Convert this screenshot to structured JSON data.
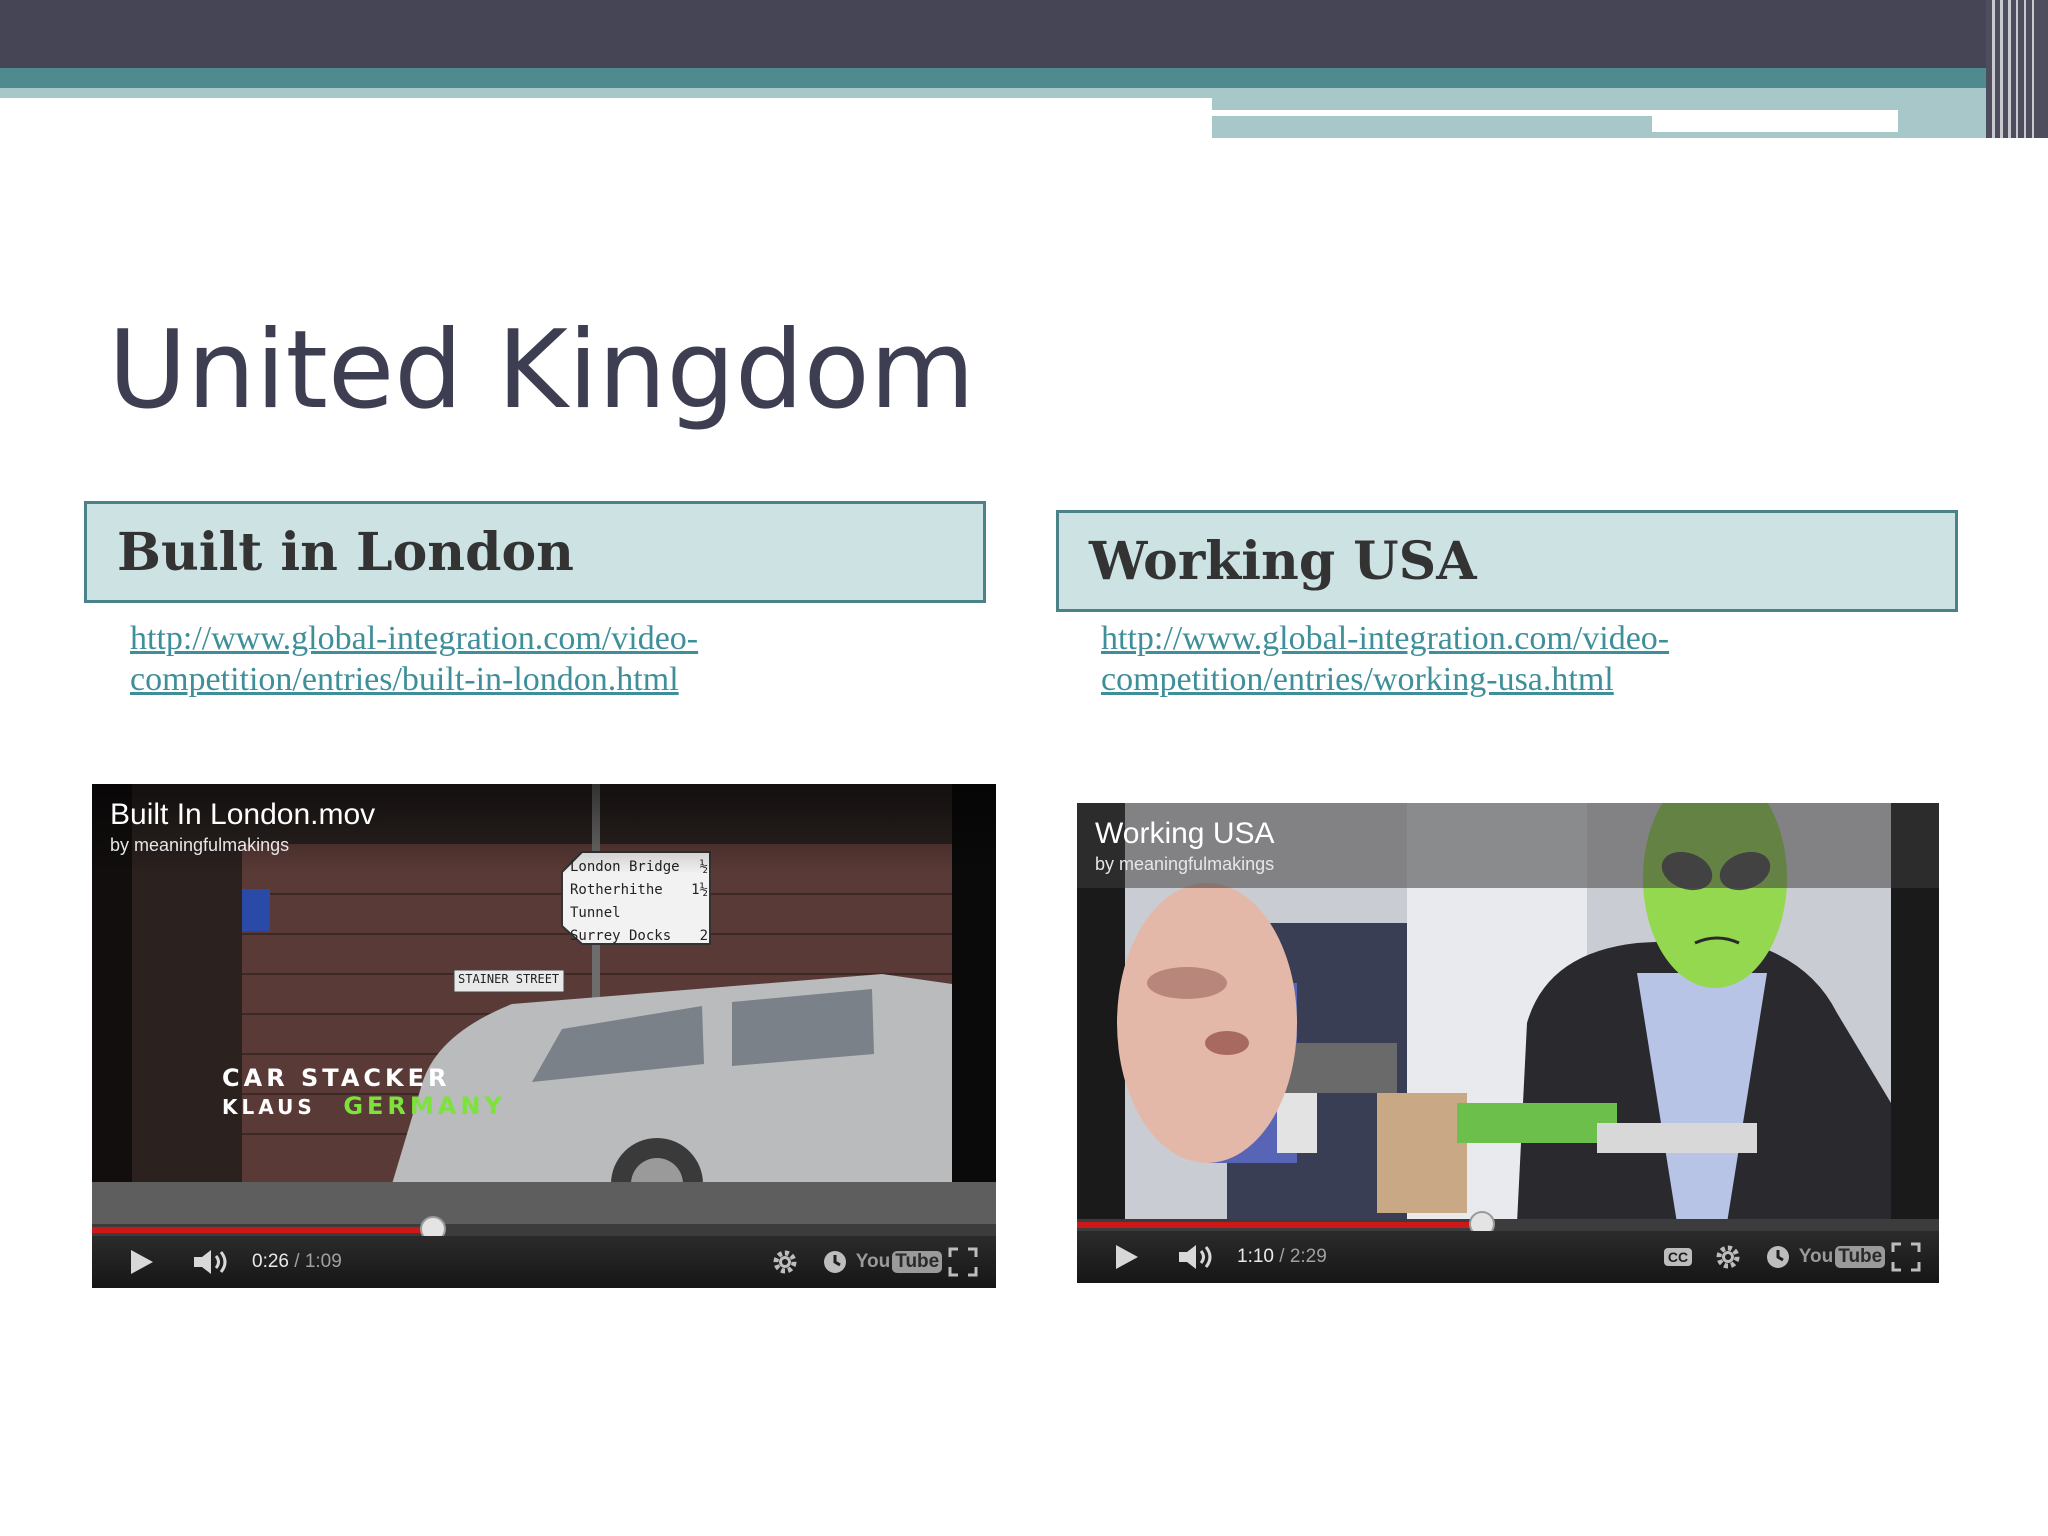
{
  "slide": {
    "title": "United Kingdom"
  },
  "videos": [
    {
      "heading": "Built in London",
      "link": "http://www.global-integration.com/video-competition/entries/built-in-london.html",
      "player": {
        "title": "Built In London.mov",
        "author": "by meaningfulmakings",
        "credit_role": "CAR STACKER",
        "credit_name": "KLAUS",
        "credit_country": "GERMANY",
        "sign_street": "STAINER STREET",
        "sign_lines": [
          "London Bridge",
          "Rotherhithe",
          "Tunnel",
          "Surrey Docks"
        ],
        "sign_distances": [
          "½",
          "1½",
          "2"
        ],
        "time_current": "0:26",
        "time_sep": " / ",
        "time_total": "1:09",
        "progress": 0.377
      }
    },
    {
      "heading": "Working USA",
      "link": "http://www.global-integration.com/video-competition/entries/working-usa.html",
      "player": {
        "title": "Working USA",
        "author": "by meaningfulmakings",
        "time_current": "1:10",
        "time_sep": " / ",
        "time_total": "2:29",
        "progress": 0.47
      }
    }
  ],
  "controls": {
    "youtube_you": "You",
    "youtube_tube": "Tube",
    "cc_label": "CC"
  },
  "colors": {
    "title_text": "#3d3e52",
    "header_bar": "#454556",
    "accent_teal": "#4f8a8f",
    "box_fill": "#cde3e3",
    "link": "#3f8f9a",
    "progress_red": "#cc1818"
  }
}
